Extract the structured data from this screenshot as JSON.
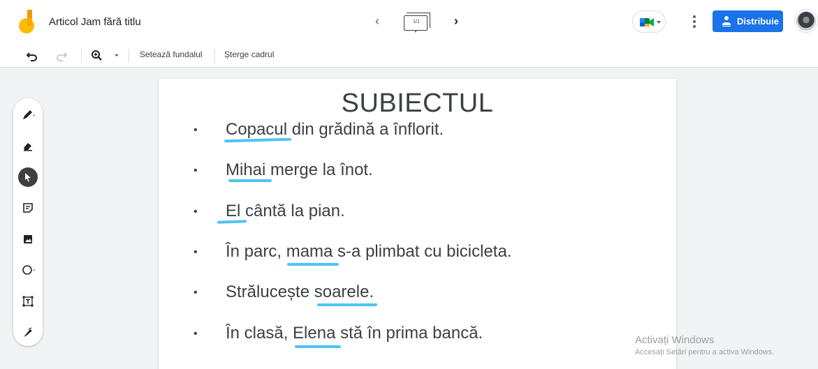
{
  "app": {
    "document_title": "Articol Jam fără titlu"
  },
  "header": {
    "frame_counter": "1/1",
    "share_label": "Distribuie"
  },
  "toolbar": {
    "set_background": "Setează fundalul",
    "clear_frame": "Șterge cadrul"
  },
  "tools": [
    {
      "name": "pen-tool",
      "icon": "pen-icon"
    },
    {
      "name": "eraser-tool",
      "icon": "eraser-icon"
    },
    {
      "name": "select-tool",
      "icon": "cursor-icon",
      "active": true
    },
    {
      "name": "sticky-note-tool",
      "icon": "sticky-note-icon"
    },
    {
      "name": "image-tool",
      "icon": "image-icon"
    },
    {
      "name": "shape-tool",
      "icon": "circle-icon"
    },
    {
      "name": "text-box-tool",
      "icon": "text-box-icon"
    },
    {
      "name": "laser-tool",
      "icon": "laser-icon"
    }
  ],
  "canvas": {
    "title": "SUBIECTUL",
    "lines": [
      "Copacul din grădină a înflorit.",
      "Mihai merge la înot.",
      "El cântă la pian.",
      "În parc, mama s-a plimbat cu bicicleta.",
      "Strălucește soarele.",
      "În clasă, Elena stă în prima bancă."
    ],
    "bullet": "•"
  },
  "watermark": {
    "line1": "Activați Windows",
    "line2": "Accesați Setări pentru a activa Windows."
  },
  "colors": {
    "accent": "#1a73e8",
    "highlight_ink": "#4fc3f7",
    "logo_yellow": "#fbbc04",
    "logo_orange": "#f29900"
  }
}
